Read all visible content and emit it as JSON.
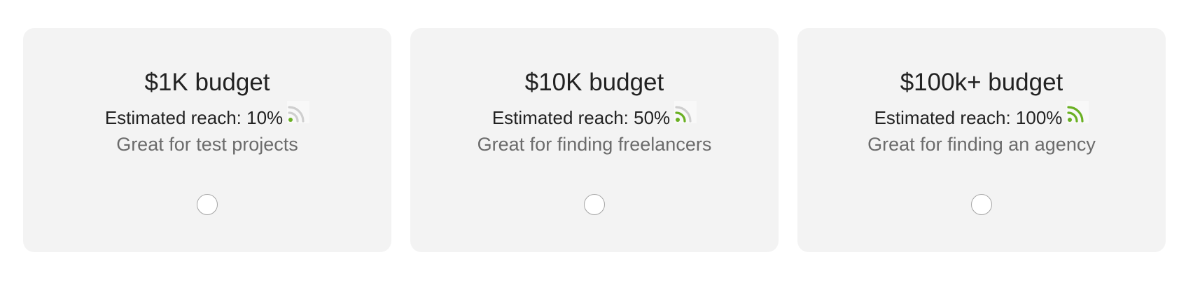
{
  "colors": {
    "card_background": "#f3f3f3",
    "signal_active": "#6ab023",
    "signal_inactive": "#cfcfcf",
    "description_text": "#6b6b6b"
  },
  "plans": [
    {
      "title": "$1K budget",
      "reach_label": "Estimated reach: 10%",
      "reach_level": 0.1,
      "signal_icon": "wifi-signal-icon",
      "description": "Great for test projects",
      "selected": false
    },
    {
      "title": "$10K budget",
      "reach_label": "Estimated reach: 50%",
      "reach_level": 0.5,
      "signal_icon": "wifi-signal-icon",
      "description": "Great for finding freelancers",
      "selected": false
    },
    {
      "title": "$100k+ budget",
      "reach_label": "Estimated reach: 100%",
      "reach_level": 1.0,
      "signal_icon": "wifi-signal-icon",
      "description": "Great for finding an agency",
      "selected": false
    }
  ]
}
